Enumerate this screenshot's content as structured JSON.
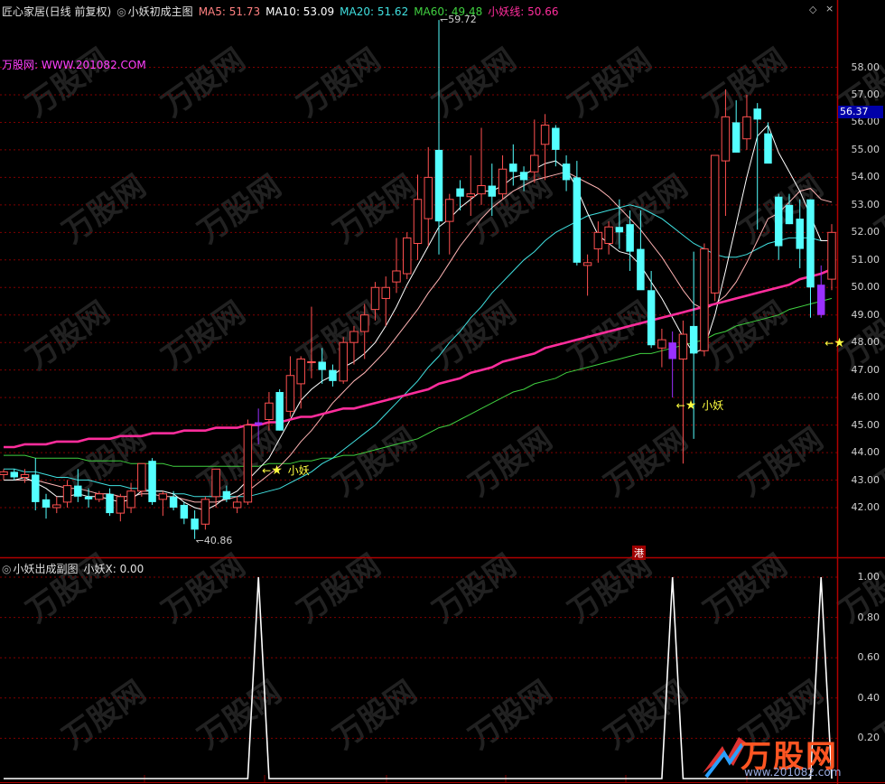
{
  "main_header": {
    "stock": "匠心家居(日线 前复权)",
    "indicator_icon": "circle-icon",
    "indicator_name": "小妖初成主图",
    "ma5": "MA5: 51.73",
    "ma10": "MA10: 53.09",
    "ma20": "MA20: 51.62",
    "ma60": "MA60: 49.48",
    "yao": "小妖线: 50.66"
  },
  "site_text": "万股网: WWW.201082.COM",
  "sub_header": {
    "indicator_icon": "circle-icon",
    "name": "小妖出成副图",
    "value": "小妖X: 0.00"
  },
  "price_axis": [
    "58.00",
    "57.00",
    "56.00",
    "55.00",
    "54.00",
    "53.00",
    "52.00",
    "51.00",
    "50.00",
    "49.00",
    "48.00",
    "47.00",
    "46.00",
    "45.00",
    "44.00",
    "43.00",
    "42.00"
  ],
  "current_price": "56.37",
  "sub_axis": [
    "1.00",
    "0.80",
    "0.60",
    "0.40",
    "0.20"
  ],
  "annotations": {
    "high": "59.72",
    "low": "40.86",
    "signal_label": "小妖",
    "hk_marker": "港"
  },
  "watermark_text": "万股网",
  "logo": {
    "main": "万股网",
    "url": "www.201082.com"
  },
  "colors": {
    "up": "#ff5050",
    "down": "#54ffff",
    "signal": "#9a30ff",
    "ma5": "#ffffff",
    "ma10": "#ffb4b4",
    "ma20": "#40e0e0",
    "ma60": "#40d040",
    "yao": "#ff2d9c",
    "grid": "#800000"
  },
  "chart_data": {
    "type": "candlestick",
    "candles": [
      [
        43.2,
        43.4,
        43.0,
        43.3
      ],
      [
        43.3,
        43.4,
        43.0,
        43.1
      ],
      [
        43.1,
        43.4,
        42.9,
        43.2
      ],
      [
        43.2,
        43.8,
        41.9,
        42.2
      ],
      [
        42.3,
        42.5,
        41.6,
        42.0
      ],
      [
        42.0,
        42.4,
        41.8,
        42.1
      ],
      [
        42.2,
        43.0,
        42.0,
        42.8
      ],
      [
        42.8,
        43.4,
        42.2,
        42.4
      ],
      [
        42.4,
        42.7,
        42.0,
        42.3
      ],
      [
        42.3,
        42.6,
        42.2,
        42.5
      ],
      [
        42.5,
        42.7,
        41.7,
        41.8
      ],
      [
        41.8,
        42.5,
        41.5,
        42.4
      ],
      [
        42.0,
        42.9,
        41.8,
        42.6
      ],
      [
        42.6,
        43.6,
        42.4,
        43.6
      ],
      [
        43.7,
        43.8,
        42.1,
        42.2
      ],
      [
        42.3,
        42.6,
        41.7,
        42.5
      ],
      [
        42.4,
        42.6,
        41.9,
        42.0
      ],
      [
        42.1,
        42.2,
        41.4,
        41.6
      ],
      [
        41.6,
        41.9,
        40.86,
        41.2
      ],
      [
        41.4,
        42.4,
        41.2,
        42.3
      ],
      [
        42.4,
        43.4,
        42.0,
        43.4
      ],
      [
        42.6,
        42.8,
        42.2,
        42.3
      ],
      [
        42.0,
        42.4,
        41.8,
        42.2
      ],
      [
        42.2,
        45.2,
        42.1,
        45.0
      ],
      [
        45.0,
        45.6,
        44.3,
        45.1
      ],
      [
        45.2,
        46.2,
        44.8,
        45.8
      ],
      [
        46.2,
        46.3,
        44.8,
        44.8
      ],
      [
        45.5,
        47.5,
        45.3,
        46.8
      ],
      [
        46.5,
        47.5,
        45.6,
        47.4
      ],
      [
        47.3,
        49.3,
        46.7,
        47.3
      ],
      [
        47.3,
        47.8,
        46.5,
        47.0
      ],
      [
        47.0,
        47.2,
        46.4,
        46.6
      ],
      [
        46.6,
        48.2,
        46.5,
        48.0
      ],
      [
        48.0,
        48.6,
        47.2,
        48.4
      ],
      [
        48.4,
        49.4,
        47.4,
        49.0
      ],
      [
        49.2,
        50.2,
        48.8,
        50.0
      ],
      [
        49.6,
        50.4,
        48.6,
        50.0
      ],
      [
        50.2,
        51.8,
        49.8,
        50.6
      ],
      [
        50.5,
        52.0,
        50.3,
        51.8
      ],
      [
        51.6,
        54.1,
        51.0,
        53.2
      ],
      [
        52.5,
        55.1,
        51.5,
        54.0
      ],
      [
        55.0,
        59.72,
        51.2,
        52.4
      ],
      [
        52.4,
        53.4,
        51.2,
        53.2
      ],
      [
        53.6,
        53.9,
        52.8,
        53.3
      ],
      [
        53.3,
        54.8,
        52.6,
        53.4
      ],
      [
        53.4,
        55.8,
        53.0,
        53.7
      ],
      [
        53.7,
        54.5,
        52.6,
        53.3
      ],
      [
        53.4,
        54.8,
        53.2,
        54.3
      ],
      [
        54.5,
        55.2,
        53.7,
        54.2
      ],
      [
        54.2,
        54.4,
        53.5,
        53.9
      ],
      [
        54.2,
        56.1,
        53.8,
        54.8
      ],
      [
        55.2,
        56.3,
        53.9,
        55.9
      ],
      [
        55.8,
        55.9,
        54.4,
        55.0
      ],
      [
        54.5,
        54.8,
        53.5,
        53.9
      ],
      [
        54.0,
        54.6,
        50.8,
        50.9
      ],
      [
        50.8,
        51.2,
        49.7,
        50.9
      ],
      [
        51.4,
        52.4,
        50.9,
        52.0
      ],
      [
        51.6,
        52.4,
        51.2,
        52.2
      ],
      [
        52.2,
        53.2,
        51.4,
        52.0
      ],
      [
        52.3,
        52.8,
        50.6,
        51.3
      ],
      [
        51.4,
        52.8,
        50.0,
        49.9
      ],
      [
        49.9,
        50.6,
        47.8,
        47.9
      ],
      [
        47.8,
        48.5,
        47.1,
        48.1
      ],
      [
        48.0,
        48.4,
        46.0,
        47.4
      ],
      [
        47.4,
        48.8,
        43.6,
        48.3
      ],
      [
        48.6,
        51.3,
        44.5,
        47.6
      ],
      [
        47.7,
        51.6,
        47.5,
        51.4
      ],
      [
        49.8,
        53.6,
        49.5,
        54.8
      ],
      [
        54.6,
        57.2,
        52.6,
        56.2
      ],
      [
        56.0,
        56.8,
        54.9,
        54.9
      ],
      [
        55.4,
        57.0,
        55.0,
        56.2
      ],
      [
        56.5,
        56.7,
        52.1,
        56.1
      ],
      [
        55.6,
        56.0,
        54.7,
        54.5
      ],
      [
        53.3,
        53.4,
        51.0,
        51.5
      ],
      [
        53.0,
        53.4,
        52.3,
        52.3
      ],
      [
        52.5,
        53.2,
        50.7,
        51.4
      ],
      [
        53.2,
        53.2,
        48.9,
        50.0
      ],
      [
        50.1,
        50.8,
        48.9,
        49.0
      ],
      [
        50.3,
        52.3,
        49.9,
        52.0
      ]
    ],
    "signal_indices": [
      24,
      63,
      77
    ],
    "ma5": [
      43.0,
      43.0,
      43.1,
      42.9,
      42.7,
      42.4,
      42.4,
      42.5,
      42.4,
      42.4,
      42.3,
      42.2,
      42.3,
      42.6,
      42.6,
      42.6,
      42.5,
      42.2,
      42.0,
      41.9,
      42.1,
      42.4,
      42.6,
      43.0,
      43.4,
      43.8,
      44.5,
      45.2,
      45.9,
      46.3,
      46.6,
      46.8,
      47.1,
      47.3,
      47.6,
      48.0,
      48.6,
      49.3,
      50.1,
      50.8,
      51.5,
      52.2,
      52.5,
      52.9,
      53.2,
      53.5,
      53.5,
      53.7,
      54.0,
      54.1,
      54.3,
      54.5,
      54.6,
      54.3,
      53.6,
      52.7,
      51.9,
      51.6,
      51.3,
      51.2,
      50.8,
      50.2,
      49.6,
      48.9,
      48.2,
      47.6,
      47.8,
      49.0,
      50.6,
      52.3,
      54.0,
      55.5,
      55.9,
      54.9,
      54.2,
      53.5,
      52.6,
      51.7,
      51.7
    ],
    "ma10": [
      43.0,
      43.0,
      43.0,
      43.0,
      42.9,
      42.8,
      42.7,
      42.7,
      42.6,
      42.5,
      42.5,
      42.4,
      42.4,
      42.5,
      42.5,
      42.4,
      42.4,
      42.3,
      42.2,
      42.2,
      42.2,
      42.3,
      42.4,
      42.6,
      42.9,
      43.2,
      43.5,
      43.9,
      44.4,
      44.8,
      45.3,
      45.8,
      46.2,
      46.6,
      46.9,
      47.3,
      47.7,
      48.2,
      48.7,
      49.2,
      49.8,
      50.3,
      50.9,
      51.5,
      52.0,
      52.5,
      52.9,
      53.2,
      53.5,
      53.7,
      53.9,
      54.0,
      54.1,
      54.2,
      54.0,
      53.8,
      53.6,
      53.3,
      52.9,
      52.5,
      52.1,
      51.6,
      51.1,
      50.5,
      49.9,
      49.4,
      49.2,
      49.4,
      49.7,
      50.2,
      50.9,
      51.7,
      52.5,
      52.7,
      53.1,
      53.5,
      53.6,
      53.2,
      53.1
    ],
    "ma20": [
      43.4,
      43.4,
      43.3,
      43.3,
      43.2,
      43.1,
      43.1,
      43.0,
      43.0,
      42.9,
      42.8,
      42.8,
      42.7,
      42.7,
      42.6,
      42.6,
      42.5,
      42.5,
      42.4,
      42.4,
      42.4,
      42.4,
      42.4,
      42.4,
      42.5,
      42.6,
      42.7,
      42.9,
      43.1,
      43.3,
      43.6,
      43.8,
      44.1,
      44.4,
      44.7,
      45.0,
      45.4,
      45.8,
      46.2,
      46.6,
      47.1,
      47.5,
      48.0,
      48.4,
      48.9,
      49.3,
      49.8,
      50.2,
      50.6,
      51.0,
      51.3,
      51.7,
      52.0,
      52.2,
      52.4,
      52.6,
      52.7,
      52.8,
      52.9,
      53.0,
      52.9,
      52.7,
      52.5,
      52.2,
      51.9,
      51.6,
      51.4,
      51.2,
      51.1,
      51.1,
      51.2,
      51.4,
      51.6,
      51.7,
      51.8,
      51.8,
      51.8,
      51.7,
      51.7
    ],
    "ma60": [
      43.9,
      43.9,
      43.9,
      43.8,
      43.8,
      43.8,
      43.8,
      43.8,
      43.7,
      43.7,
      43.7,
      43.7,
      43.6,
      43.6,
      43.6,
      43.6,
      43.5,
      43.5,
      43.5,
      43.5,
      43.5,
      43.5,
      43.5,
      43.5,
      43.5,
      43.6,
      43.6,
      43.6,
      43.7,
      43.7,
      43.8,
      43.8,
      43.9,
      43.9,
      44.0,
      44.1,
      44.2,
      44.3,
      44.4,
      44.5,
      44.7,
      44.9,
      45.0,
      45.2,
      45.4,
      45.6,
      45.8,
      46.0,
      46.2,
      46.3,
      46.5,
      46.6,
      46.7,
      46.9,
      47.0,
      47.1,
      47.2,
      47.3,
      47.4,
      47.5,
      47.6,
      47.6,
      47.7,
      47.8,
      47.9,
      48.0,
      48.1,
      48.3,
      48.4,
      48.6,
      48.7,
      48.8,
      48.9,
      49.0,
      49.2,
      49.3,
      49.4,
      49.5,
      49.6
    ],
    "yao": [
      44.2,
      44.2,
      44.3,
      44.3,
      44.3,
      44.4,
      44.4,
      44.4,
      44.5,
      44.5,
      44.5,
      44.6,
      44.6,
      44.6,
      44.7,
      44.7,
      44.7,
      44.8,
      44.8,
      44.8,
      44.9,
      44.9,
      44.9,
      45.0,
      45.0,
      45.1,
      45.1,
      45.2,
      45.3,
      45.3,
      45.4,
      45.5,
      45.6,
      45.6,
      45.7,
      45.8,
      45.9,
      46.0,
      46.1,
      46.2,
      46.3,
      46.5,
      46.6,
      46.7,
      46.9,
      47.0,
      47.1,
      47.3,
      47.4,
      47.5,
      47.6,
      47.8,
      47.9,
      48.0,
      48.1,
      48.2,
      48.3,
      48.4,
      48.5,
      48.6,
      48.7,
      48.8,
      48.9,
      49.0,
      49.1,
      49.2,
      49.3,
      49.4,
      49.5,
      49.6,
      49.7,
      49.8,
      49.9,
      50.0,
      50.1,
      50.3,
      50.4,
      50.5,
      50.66
    ],
    "sub_series": {
      "name": "小妖X",
      "signal_indices": [
        24,
        63,
        77
      ],
      "values_on": 1.0,
      "values_off": 0.0
    },
    "ylim_main": [
      41.0,
      59.5
    ],
    "ylim_sub": [
      0,
      1.08
    ]
  }
}
